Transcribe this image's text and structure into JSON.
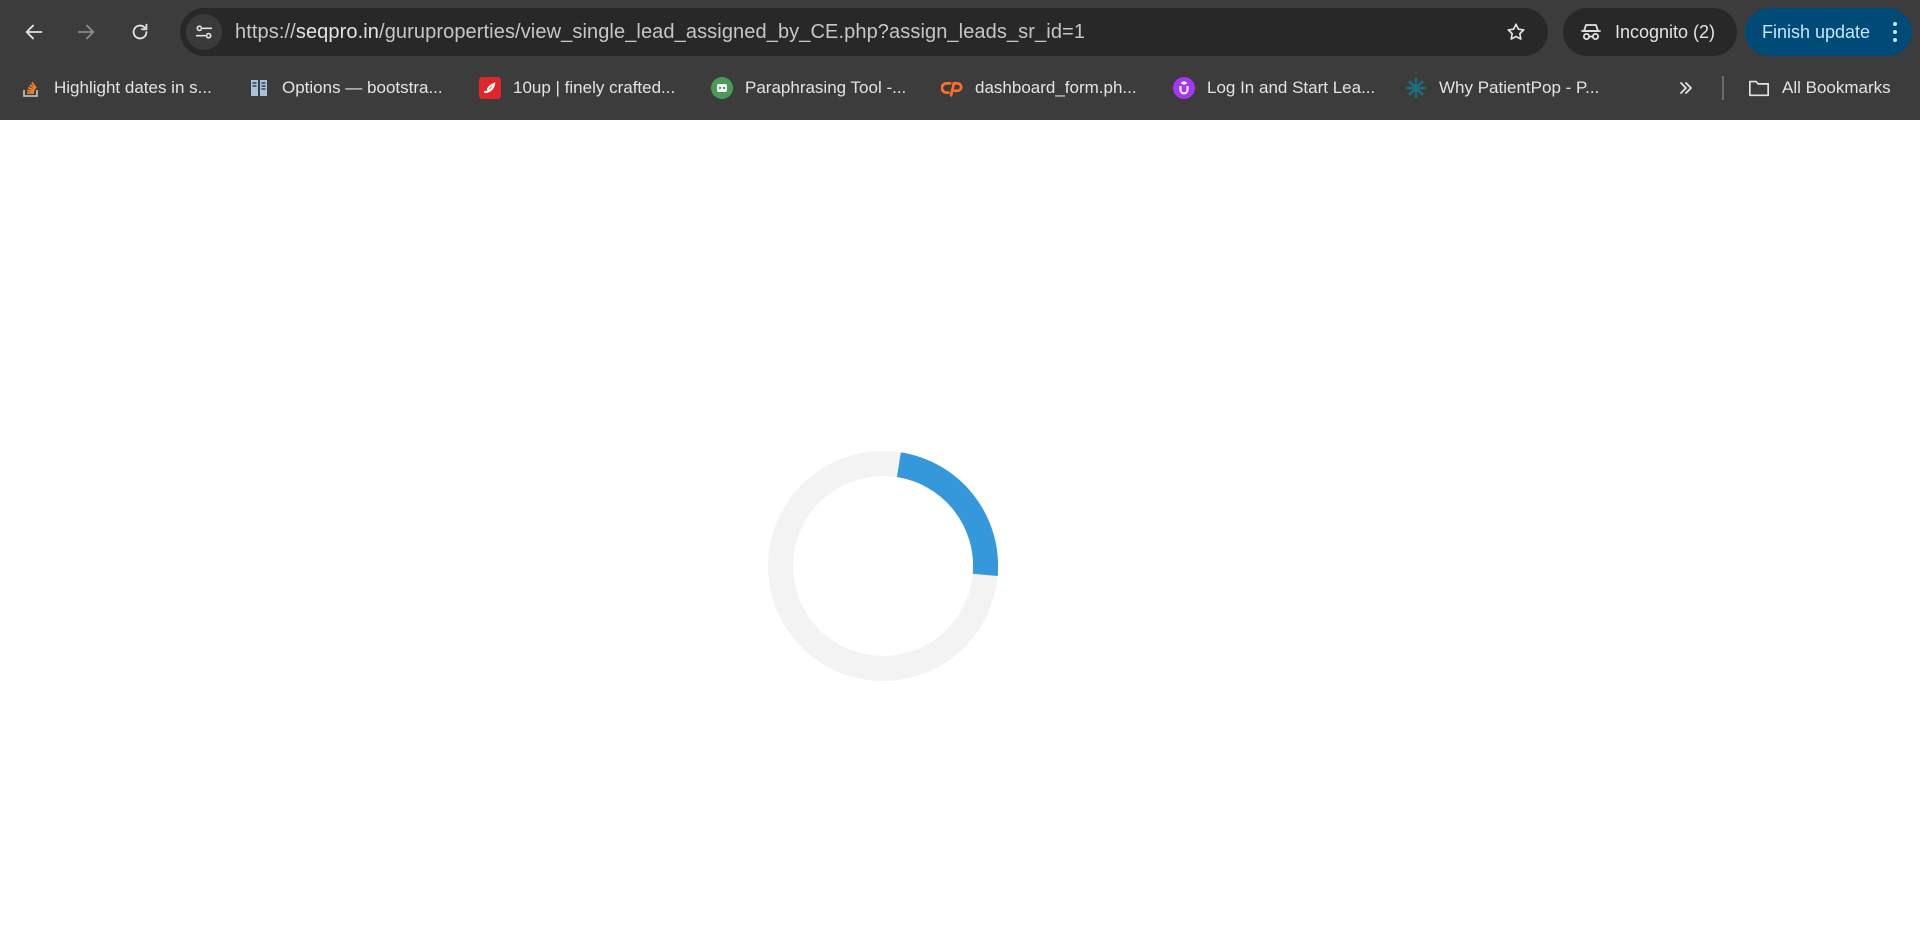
{
  "browser": {
    "url_scheme": "https://",
    "url_host": "seqpro.in",
    "url_path": "/guruproperties/view_single_lead_assigned_by_CE.php?assign_leads_sr_id=1",
    "incognito_label": "Incognito (2)",
    "finish_update_label": "Finish update",
    "accent_color": "#004a77"
  },
  "bookmarks": {
    "items": [
      {
        "label": "Highlight dates in s...",
        "icon": "stackoverflow-icon",
        "color": "#f48024"
      },
      {
        "label": "Options — bootstra...",
        "icon": "document-icon",
        "color": "#a9c2dc"
      },
      {
        "label": "10up | finely crafted...",
        "icon": "10up-logo-icon",
        "color": "#e0262a"
      },
      {
        "label": "Paraphrasing Tool -...",
        "icon": "robot-icon",
        "color": "#4a9b57"
      },
      {
        "label": "dashboard_form.ph...",
        "icon": "cpanel-icon",
        "color": "#ff6c2c"
      },
      {
        "label": "Log In and Start Lea...",
        "icon": "udemy-icon",
        "color": "#a435f0"
      },
      {
        "label": "Why PatientPop - P...",
        "icon": "patientpop-icon",
        "color": "#1b6f7a"
      }
    ],
    "all_bookmarks_label": "All Bookmarks"
  },
  "page": {
    "loader": {
      "track_color": "#f3f3f3",
      "arc_color": "#3498db"
    }
  }
}
